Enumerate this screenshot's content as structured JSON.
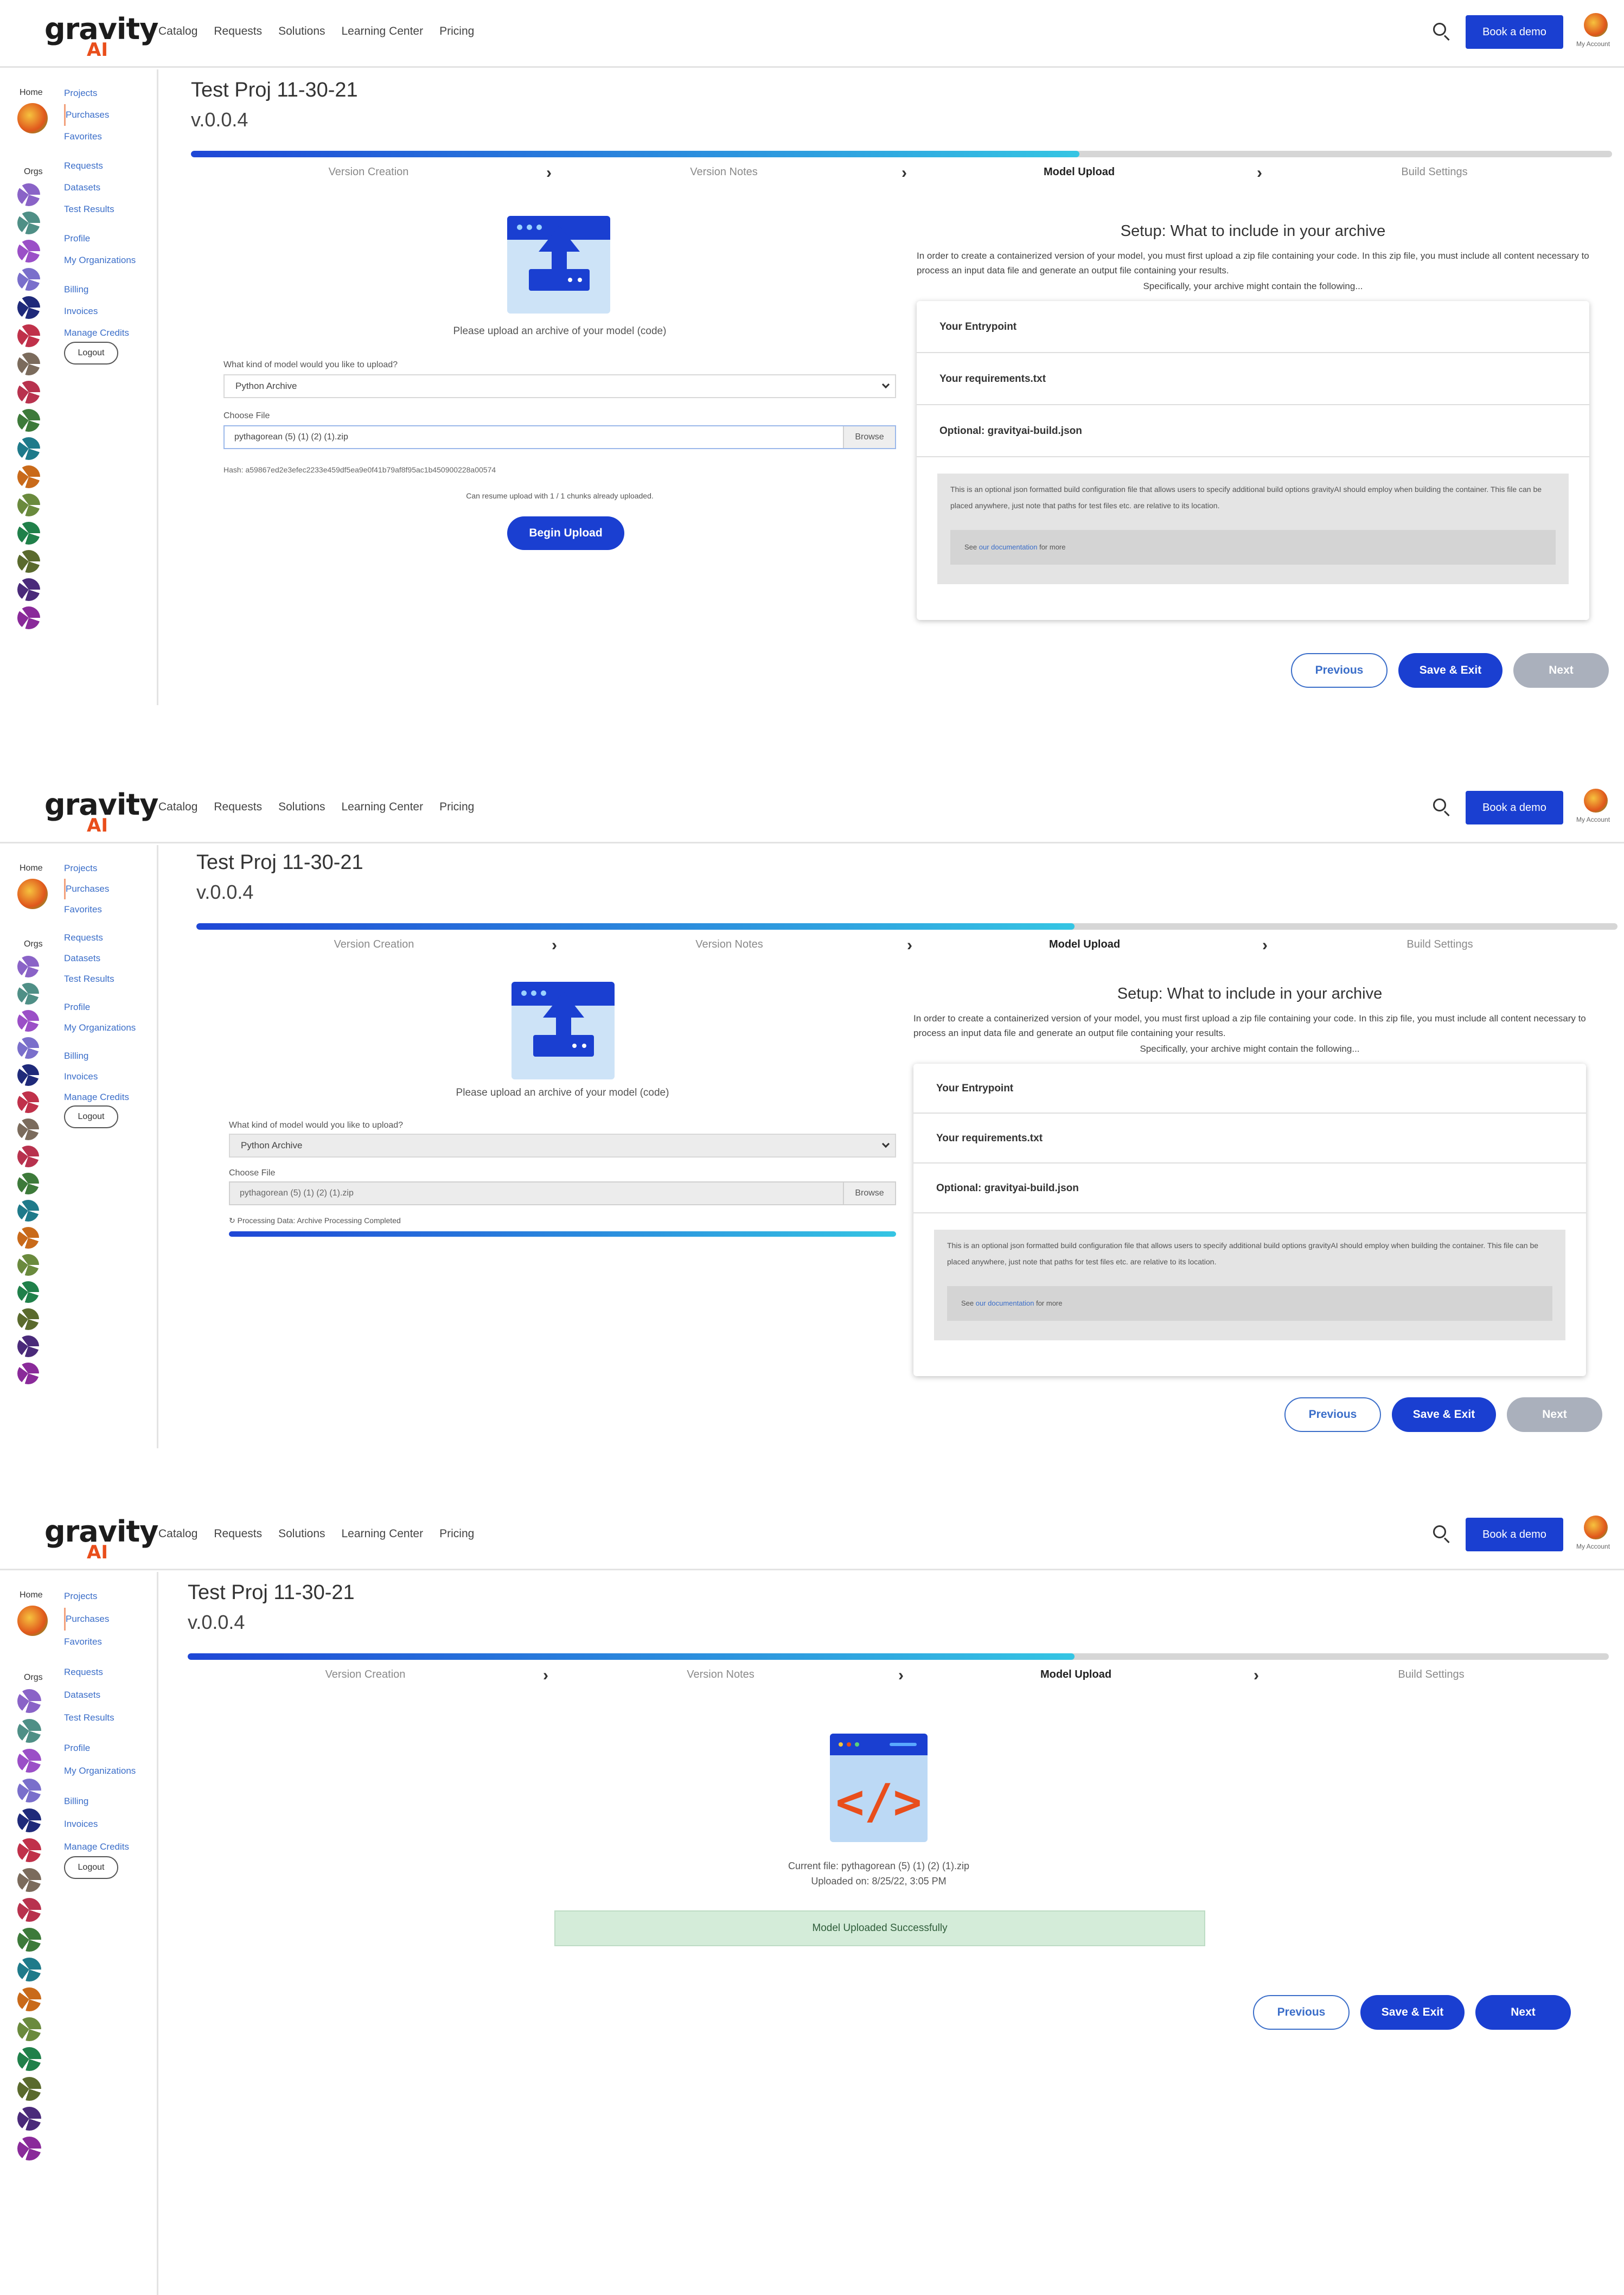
{
  "header": {
    "logo_word": "gravity",
    "logo_suffix": "AI",
    "nav": [
      "Catalog",
      "Requests",
      "Solutions",
      "Learning Center",
      "Pricing"
    ],
    "demo_button": "Book a demo",
    "account_label": "My Account"
  },
  "sidebar": {
    "home_label": "Home",
    "orgs_label": "Orgs",
    "links": [
      "Projects",
      "Purchases",
      "Favorites",
      "Requests",
      "Datasets",
      "Test Results",
      "Profile",
      "My Organizations",
      "Billing",
      "Invoices",
      "Manage Credits"
    ],
    "logout": "Logout",
    "org_colors": [
      "#8a63c7",
      "#4f8f86",
      "#9b4fc7",
      "#7a6fcb",
      "#1f2a7a",
      "#c0314a",
      "#7b6b5c",
      "#b8324e",
      "#3d7a3a",
      "#1f7a8a",
      "#c96a1a",
      "#6a8a3d",
      "#20804a",
      "#5a6a2d",
      "#4a2a7a",
      "#8a2a9a"
    ]
  },
  "project": {
    "title": "Test Proj 11-30-21",
    "version": "v.0.0.4"
  },
  "steps": [
    "Version Creation",
    "Version Notes",
    "Model Upload",
    "Build Settings"
  ],
  "progress": {
    "panel1": 0.625,
    "panel2": 0.618,
    "panel3": 0.624
  },
  "upload": {
    "instruction": "Please upload an archive of your model (code)",
    "model_kind_label": "What kind of model would you like to upload?",
    "model_kind_value": "Python Archive",
    "choose_file_label": "Choose File",
    "file_value": "pythagorean (5) (1) (2) (1).zip",
    "browse": "Browse",
    "hash": "Hash: a59867ed2e3efec2233e459df5ea9e0f41b79af8f95ac1b450900228a00574",
    "resume_text": "Can resume upload with 1 / 1 chunks already uploaded.",
    "begin_upload": "Begin Upload",
    "processing_text": "Processing Data: Archive Processing Completed"
  },
  "setup": {
    "title": "Setup: What to include in your archive",
    "description": "In order to create a containerized version of your model, you must first upload a zip file containing your code. In this zip file, you must include all content necessary to process an input data file and generate an output file containing your results.",
    "sub": "Specifically, your archive might contain the following...",
    "rows": [
      "Your Entrypoint",
      "Your requirements.txt",
      "Optional: gravityai-build.json"
    ],
    "body_text": "This is an optional json formatted build configuration file that allows users to specify additional build options gravityAI should employ when building the container. This file can be placed anywhere, just note that paths for test files etc. are relative to its location.",
    "doc_prefix": "See",
    "doc_link": "our documentation",
    "doc_suffix": "for more"
  },
  "result": {
    "current_file": "Current file: pythagorean (5) (1) (2) (1).zip",
    "uploaded_on": "Uploaded on: 8/25/22, 3:05 PM",
    "success": "Model Uploaded Successfully"
  },
  "buttons": {
    "previous": "Previous",
    "save_exit": "Save & Exit",
    "next": "Next"
  },
  "colors": {
    "brand_blue": "#1a3fd1",
    "accent_orange": "#e94e1b",
    "success_bg": "#d4ecd9"
  },
  "icons": [
    "search-icon",
    "chevron-right-icon",
    "upload-icon",
    "code-file-icon",
    "refresh-icon",
    "caret-down-icon"
  ]
}
